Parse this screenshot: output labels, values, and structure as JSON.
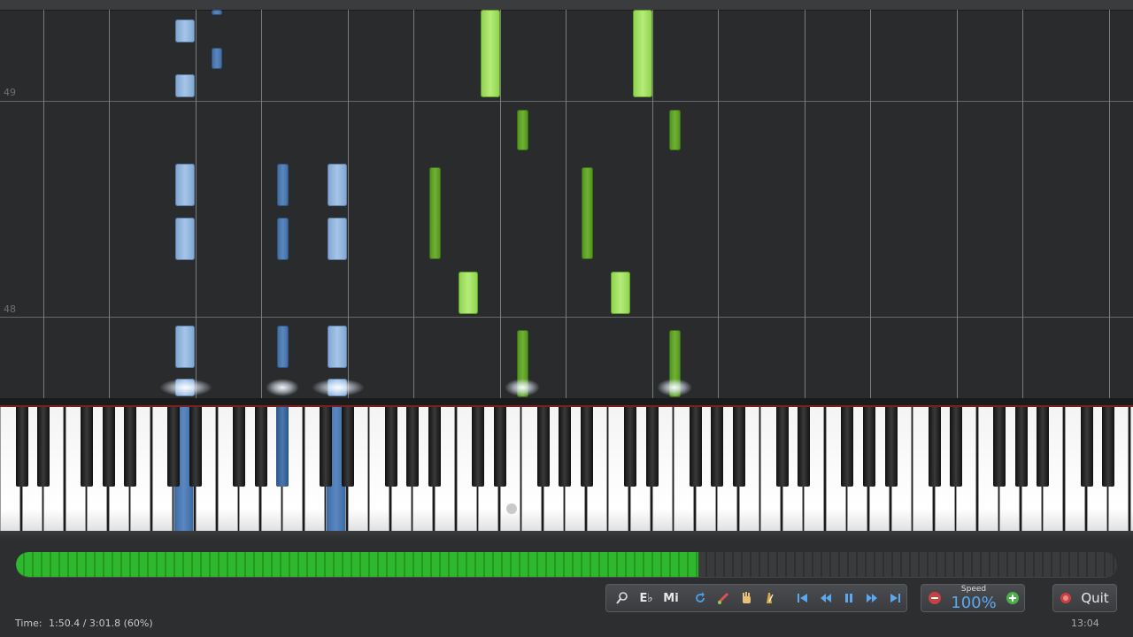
{
  "measures": {
    "m49": "49",
    "m48": "48"
  },
  "progress": {
    "fraction": 0.605
  },
  "toolbar": {
    "zoom_icon": "magnifier-icon",
    "key_label": "E♭",
    "note_names_label": "Mi",
    "loop_icon": "loop-icon",
    "mark_icon": "pencil-icon",
    "hand_icon": "hand-icon",
    "metronome_icon": "metronome-icon",
    "skip_start_icon": "skip-to-start-icon",
    "rewind_icon": "rewind-icon",
    "pause_icon": "pause-icon",
    "forward_icon": "fast-forward-icon",
    "skip_end_icon": "skip-to-end-icon"
  },
  "speed": {
    "label": "Speed",
    "value": "100%",
    "decrease": "−",
    "increase": "+"
  },
  "quit": {
    "label": "Quit"
  },
  "status": {
    "time_label": "Time:",
    "time_value": "1:50.4 / 3:01.8 (60%)",
    "clock": "13:04"
  },
  "colors": {
    "left_hand": "#7ea4cf",
    "right_hand": "#8bd24a",
    "progress": "#2fb82f"
  }
}
